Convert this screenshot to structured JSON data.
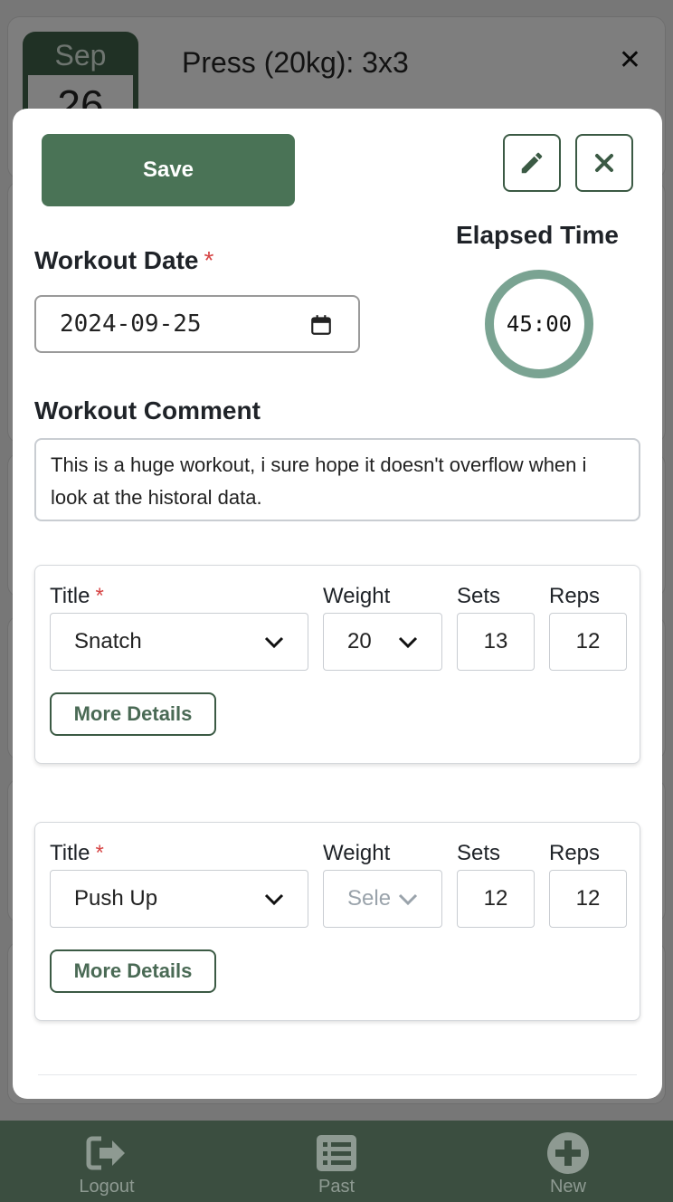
{
  "background": {
    "card": {
      "month": "Sep",
      "day": "26",
      "title": "Press (20kg): 3x3",
      "close_glyph": "✕"
    }
  },
  "modal": {
    "save_label": "Save",
    "edit_icon": "pencil-icon",
    "close_icon": "close-icon",
    "workout_date": {
      "label": "Workout Date",
      "required_mark": "*",
      "value": "2024-09-25"
    },
    "elapsed": {
      "label": "Elapsed Time",
      "value": "45:00"
    },
    "comment": {
      "label": "Workout Comment",
      "value": "This is a huge workout, i sure hope it doesn't overflow when i look at the historal data."
    },
    "exercises": [
      {
        "title_label": "Title",
        "title_value": "Snatch",
        "weight_label": "Weight",
        "weight_value": "20",
        "sets_label": "Sets",
        "sets_value": "13",
        "reps_label": "Reps",
        "reps_value": "12",
        "more_label": "More Details"
      },
      {
        "title_label": "Title",
        "title_value": "Push Up",
        "weight_label": "Weight",
        "weight_placeholder": "Sele",
        "sets_label": "Sets",
        "sets_value": "12",
        "reps_label": "Reps",
        "reps_value": "12",
        "more_label": "More Details"
      }
    ]
  },
  "nav": {
    "items": [
      {
        "label": "Logout",
        "icon": "logout-icon"
      },
      {
        "label": "Past",
        "icon": "list-icon"
      },
      {
        "label": "New",
        "icon": "plus-circle-icon"
      }
    ]
  },
  "colors": {
    "accent": "#4a7356",
    "accent_dark": "#3b5a44",
    "timer_ring": "#7aa392",
    "required": "#d64545",
    "nav_bg": "#3b4e40"
  }
}
